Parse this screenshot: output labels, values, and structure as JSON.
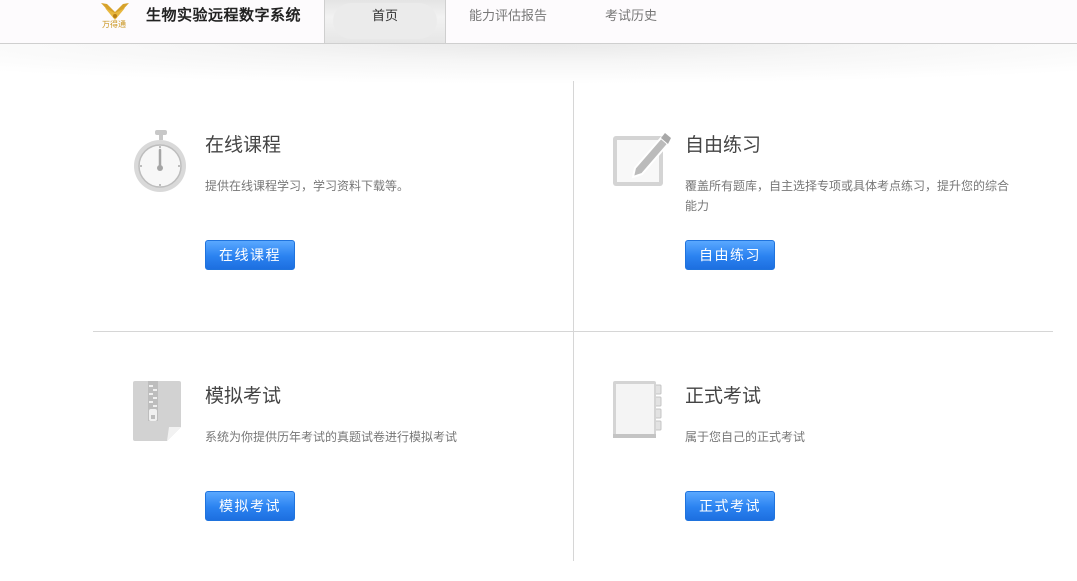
{
  "header": {
    "logo_text": "万得通",
    "app_title": "生物实验远程数字系统",
    "tabs": [
      {
        "label": "首页",
        "active": true
      },
      {
        "label": "能力评估报告",
        "active": false
      },
      {
        "label": "考试历史",
        "active": false
      }
    ]
  },
  "cards": [
    {
      "icon": "stopwatch-icon",
      "title": "在线课程",
      "description": "提供在线课程学习，学习资料下载等。",
      "button": "在线课程"
    },
    {
      "icon": "edit-pencil-icon",
      "title": "自由练习",
      "description": "覆盖所有题库，自主选择专项或具体考点练习，提升您的综合能力",
      "button": "自由练习"
    },
    {
      "icon": "zip-file-icon",
      "title": "模拟考试",
      "description": "系统为你提供历年考试的真题试卷进行模拟考试",
      "button": "模拟考试"
    },
    {
      "icon": "notebook-icon",
      "title": "正式考试",
      "description": "属于您自己的正式考试",
      "button": "正式考试"
    }
  ],
  "colors": {
    "accent": "#2a82f0",
    "logo_gold": "#c9941f"
  }
}
